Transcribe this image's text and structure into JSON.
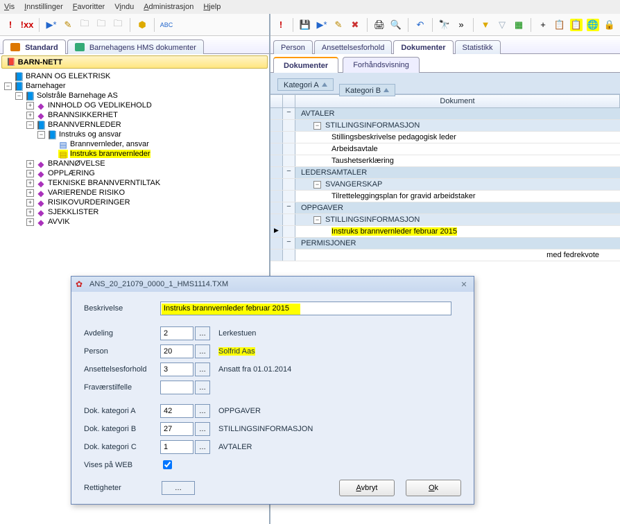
{
  "menu": {
    "items": [
      "Vis",
      "Innstillinger",
      "Favoritter",
      "Vindu",
      "Administrasjon",
      "Hjelp"
    ]
  },
  "left": {
    "tabs": [
      {
        "label": "Standard",
        "active": true
      },
      {
        "label": "Barnehagens HMS dokumenter",
        "active": false
      }
    ],
    "root": "BARN-NETT",
    "tree": {
      "brann_elektrisk": "BRANN OG ELEKTRISK",
      "barnehager": "Barnehager",
      "solstrale": "Solstråle Barnehage AS",
      "innhold": "INNHOLD OG VEDLIKEHOLD",
      "brannsikkerhet": "BRANNSIKKERHET",
      "brannvernleder": "BRANNVERNLEDER",
      "instruks_og_ansvar": "Instruks og ansvar",
      "brannvernleder_ansvar": "Brannvernleder, ansvar",
      "instruks_brannvernleder": "Instruks brannvernleder",
      "brannovelse": "BRANNØVELSE",
      "opplaering": "OPPLÆRING",
      "tekniske": "TEKNISKE BRANNVERNTILTAK",
      "varierende": "VARIERENDE RISIKO",
      "risikovurderinger": "RISIKOVURDERINGER",
      "sjekklister": "SJEKKLISTER",
      "avvik": "AVVIK"
    }
  },
  "right": {
    "maintabs": [
      {
        "label": "Person"
      },
      {
        "label": "Ansettelsesforhold"
      },
      {
        "label": "Dokumenter",
        "active": true
      },
      {
        "label": "Statistikk"
      }
    ],
    "subtabs": [
      {
        "label": "Dokumenter",
        "active": true
      },
      {
        "label": "Forhåndsvisning"
      }
    ],
    "cat_a": "Kategori A",
    "cat_b": "Kategori B",
    "col_dokument": "Dokument",
    "rows": {
      "avtaler": "AVTALER",
      "stillingsinfo": "STILLINGSINFORMASJON",
      "stillingsbeskrivelse": "Stillingsbeskrivelse pedagogisk leder",
      "arbeidsavtale": "Arbeidsavtale",
      "taushet": "Taushetserklæring",
      "ledersamtaler": "LEDERSAMTALER",
      "svangerskap": "SVANGERSKAP",
      "tilrettelegging": "Tilretteleggingsplan for gravid arbeidstaker",
      "oppgaver": "OPPGAVER",
      "stillingsinfo2": "STILLINGSINFORMASJON",
      "instruks_feb": "Instruks brannvernleder februar 2015",
      "permisjoner": "PERMISJONER",
      "fedrekvote": "med fedrekvote"
    }
  },
  "dialog": {
    "title": "ANS_20_21079_0000_1_HMS1114.TXM",
    "beskrivelse_lab": "Beskrivelse",
    "beskrivelse_val": "Instruks brannvernleder februar 2015",
    "avdeling_lab": "Avdeling",
    "avdeling_val": "2",
    "avdeling_desc": "Lerkestuen",
    "person_lab": "Person",
    "person_val": "20",
    "person_desc": "Solfrid Aas",
    "ansettelse_lab": "Ansettelsesforhold",
    "ansettelse_val": "3",
    "ansettelse_desc": "Ansatt fra 01.01.2014",
    "fravaer_lab": "Fraværstilfelle",
    "fravaer_val": "",
    "katA_lab": "Dok. kategori A",
    "katA_val": "42",
    "katA_desc": "OPPGAVER",
    "katB_lab": "Dok. kategori B",
    "katB_val": "27",
    "katB_desc": "STILLINGSINFORMASJON",
    "katC_lab": "Dok. kategori C",
    "katC_val": "1",
    "katC_desc": "AVTALER",
    "web_lab": "Vises på WEB",
    "rettigheter_lab": "Rettigheter",
    "btn_cancel": "Avbryt",
    "btn_ok": "Ok"
  }
}
